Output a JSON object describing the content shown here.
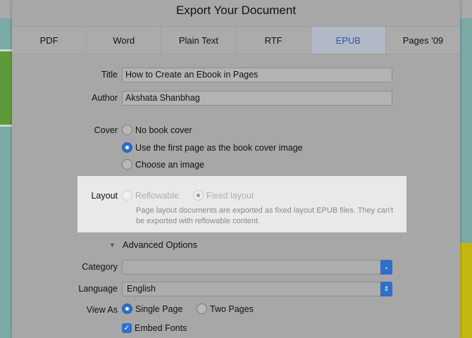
{
  "dialog": {
    "title": "Export Your Document"
  },
  "tabs": [
    {
      "label": "PDF"
    },
    {
      "label": "Word"
    },
    {
      "label": "Plain Text"
    },
    {
      "label": "RTF"
    },
    {
      "label": "EPUB"
    },
    {
      "label": "Pages '09"
    }
  ],
  "form": {
    "title_label": "Title",
    "title_value": "How to Create an Ebook in Pages",
    "author_label": "Author",
    "author_value": "Akshata Shanbhag",
    "cover_label": "Cover",
    "cover_options": [
      {
        "label": "No book cover",
        "selected": false
      },
      {
        "label": "Use the first page as the book cover image",
        "selected": true
      },
      {
        "label": "Choose an image",
        "selected": false
      }
    ],
    "layout_label": "Layout",
    "layout_options": [
      {
        "label": "Reflowable",
        "selected": false
      },
      {
        "label": "Fixed layout",
        "selected": true
      }
    ],
    "layout_note": "Page layout documents are exported as fixed layout EPUB files. They can't be exported with reflowable content.",
    "advanced_label": "Advanced Options",
    "category_label": "Category",
    "category_value": "",
    "language_label": "Language",
    "language_value": "English",
    "viewas_label": "View As",
    "viewas_options": [
      {
        "label": "Single Page",
        "selected": true
      },
      {
        "label": "Two Pages",
        "selected": false
      }
    ],
    "embed_fonts_label": "Embed Fonts",
    "embed_fonts_checked": true
  },
  "colors": {
    "accent": "#2f6fc7"
  }
}
